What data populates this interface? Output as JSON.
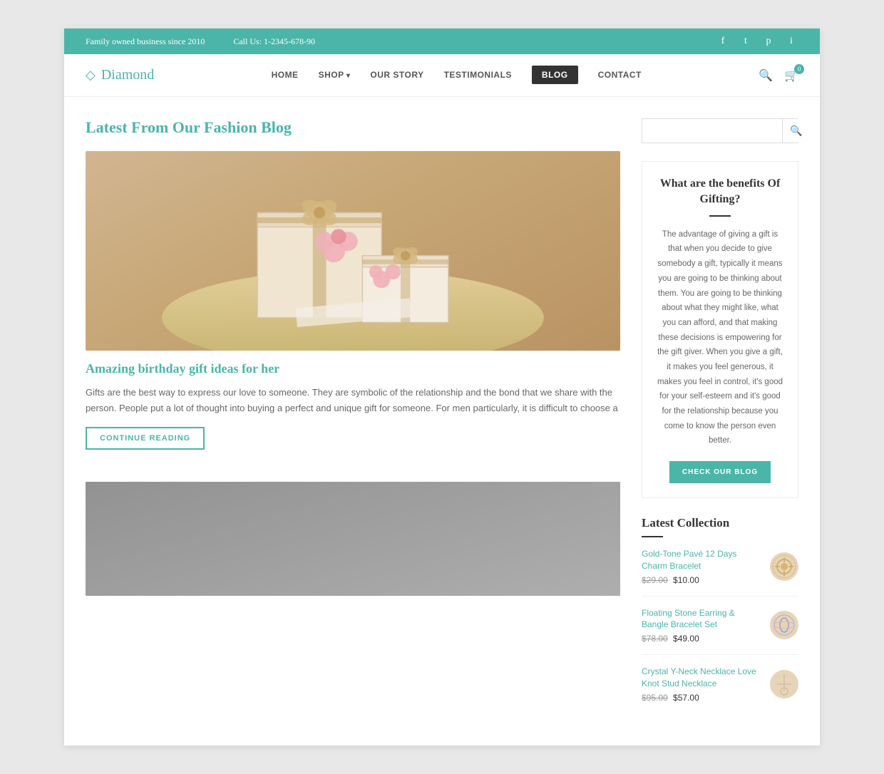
{
  "topbar": {
    "tagline": "Family owned business since 2010",
    "phone": "Call Us: 1-2345-678-90",
    "social": [
      "f",
      "𝕋",
      "♥",
      "◉"
    ]
  },
  "nav": {
    "logo": "Diamond",
    "links": [
      {
        "label": "HOME",
        "active": false,
        "dropdown": false
      },
      {
        "label": "SHOP",
        "active": false,
        "dropdown": true
      },
      {
        "label": "OUR STORY",
        "active": false,
        "dropdown": false
      },
      {
        "label": "TESTIMONIALS",
        "active": false,
        "dropdown": false
      },
      {
        "label": "BLOG",
        "active": true,
        "dropdown": false
      },
      {
        "label": "CONTACT",
        "active": false,
        "dropdown": false
      }
    ],
    "cart_count": "0"
  },
  "blog": {
    "title": "Latest From Our Fashion Blog",
    "post1": {
      "title": "Amazing birthday gift ideas for her",
      "excerpt": "Gifts are the best way to express our love to someone. They are symbolic of the relationship and the bond that we share with the person. People put a lot of thought into buying a perfect and unique gift for someone. For men particularly, it is difficult to choose a",
      "continue_label": "CONTINUE READING"
    }
  },
  "sidebar": {
    "search_placeholder": "",
    "gifting_card": {
      "title": "What are the benefits Of Gifting?",
      "text": "The advantage of giving a gift is that when you decide to give somebody a gift, typically it means you are going to be thinking about them. You are going to be thinking about what they might like, what you can afford, and that making these decisions is empowering for the gift giver. When you give a gift, it makes you feel generous, it makes you feel in control, it's good for your self-esteem and it's good for the relationship because you come to know the person even better.",
      "button_label": "CHECK OUR BLOG"
    },
    "collection": {
      "title": "Latest Collection",
      "items": [
        {
          "name": "Gold-Tone Pavé 12 Days Charm Bracelet",
          "price_old": "$29.00",
          "price_new": "$10.00",
          "icon": "⊕"
        },
        {
          "name": "Floating Stone Earring & Bangle Bracelet Set",
          "price_old": "$78.00",
          "price_new": "$49.00",
          "icon": "◯"
        },
        {
          "name": "Crystal Y-Neck Necklace Love Knot Stud Necklace",
          "price_old": "$95.00",
          "price_new": "$57.00",
          "icon": "⌂"
        }
      ]
    }
  }
}
